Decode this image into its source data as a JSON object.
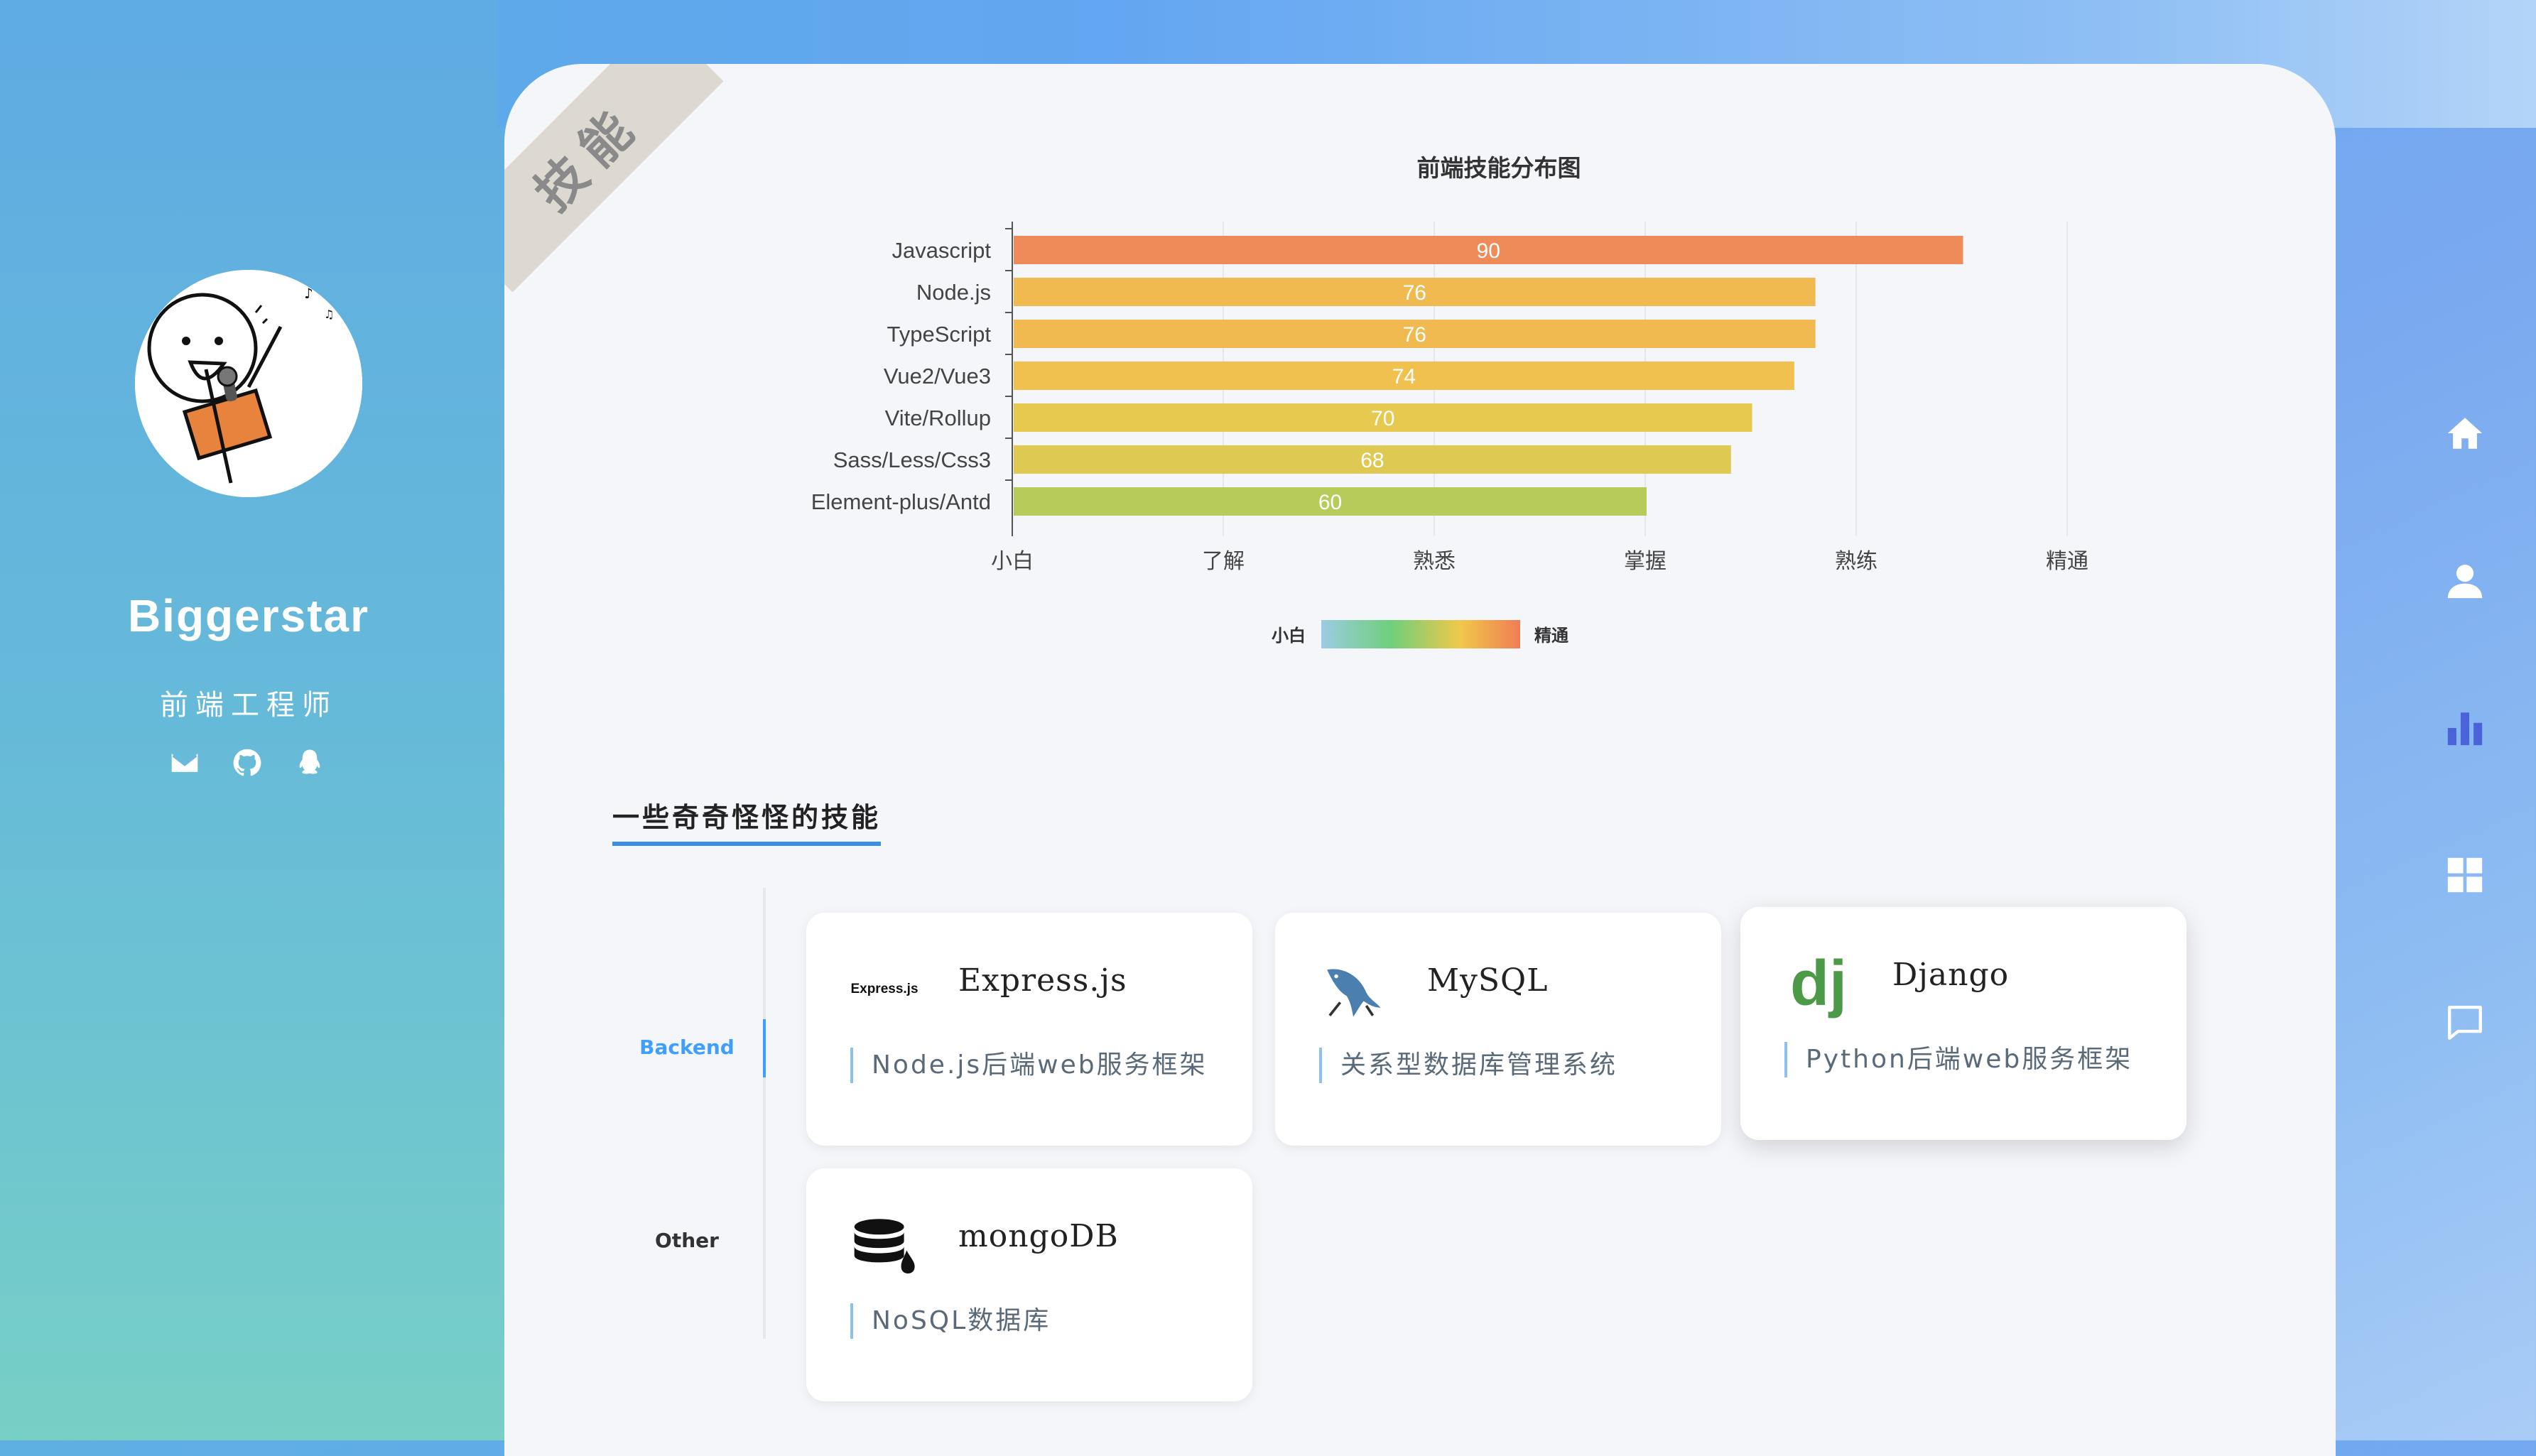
{
  "profile": {
    "name": "Biggerstar",
    "role": "前端工程师",
    "social_icons": [
      "mail-icon",
      "github-icon",
      "qq-icon"
    ]
  },
  "ribbon": {
    "label": "技能"
  },
  "chart_data": {
    "type": "bar",
    "orientation": "horizontal",
    "title": "前端技能分布图",
    "categories": [
      "Javascript",
      "Node.js",
      "TypeScript",
      "Vue2/Vue3",
      "Vite/Rollup",
      "Sass/Less/Css3",
      "Element-plus/Antd"
    ],
    "values": [
      90,
      76,
      76,
      74,
      70,
      68,
      60
    ],
    "x_tick_labels": [
      "小白",
      "了解",
      "熟悉",
      "掌握",
      "熟练",
      "精通"
    ],
    "xlim": [
      0,
      100
    ],
    "grid": true,
    "data_labels": true,
    "visual_map": {
      "min_label": "小白",
      "max_label": "精通",
      "colors": [
        "#8fc1e0",
        "#6fcf7c",
        "#f0c84a",
        "#f08a5d"
      ]
    }
  },
  "section": {
    "title": "一些奇奇怪怪的技能"
  },
  "tabs": [
    {
      "label": "Backend",
      "active": true
    },
    {
      "label": "Other",
      "active": false
    }
  ],
  "skills": [
    {
      "title": "Express.js",
      "logo_text": "Express.js",
      "desc": "Node.js后端web服务框架",
      "icon": "express-logo"
    },
    {
      "title": "MySQL",
      "desc": "关系型数据库管理系统",
      "icon": "mysql-dolphin-icon"
    },
    {
      "title": "Django",
      "logo_text": "dj",
      "desc": "Python后端web服务框架",
      "icon": "django-logo"
    },
    {
      "title": "mongoDB",
      "desc": "NoSQL数据库",
      "icon": "database-icon"
    }
  ],
  "nav": [
    "home-icon",
    "user-icon",
    "bar-chart-icon",
    "grid-icon",
    "chat-icon"
  ],
  "colors": {
    "accent": "#409eff",
    "nav_active": "#4a63d8",
    "bar_high": "#ee8b58",
    "bar_low": "#b7cb5a"
  }
}
